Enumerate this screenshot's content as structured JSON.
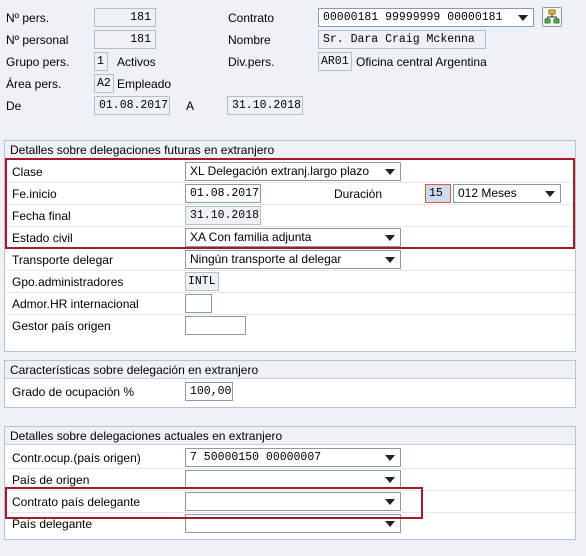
{
  "header": {
    "nr_pers_label": "Nº pers.",
    "nr_pers_value": "181",
    "nr_personal_label": "Nº personal",
    "nr_personal_value": "181",
    "grupo_label": "Grupo pers.",
    "grupo_code": "1",
    "grupo_text": "Activos",
    "area_label": "Área pers.",
    "area_code": "A2",
    "area_text": "Empleado",
    "de_label": "De",
    "de_value": "01.08.2017",
    "a_label": "A",
    "a_value": "31.10.2018",
    "contrato_label": "Contrato",
    "contrato_value": "00000181 99999999 00000181",
    "nombre_label": "Nombre",
    "nombre_value": "Sr. Dara Craig Mckenna",
    "div_label": "Div.pers.",
    "div_code": "AR01",
    "div_text": "Oficina central Argentina"
  },
  "future": {
    "title": "Detalles sobre delegaciones futuras en extranjero",
    "clase_label": "Clase",
    "clase_value": "XL Delegación extranj.largo plazo",
    "feinicio_label": "Fe.inicio",
    "feinicio_value": "01.08.2017",
    "duracion_label": "Duración",
    "duracion_value": "15",
    "duracion_unit": "012 Meses",
    "fechafinal_label": "Fecha final",
    "fechafinal_value": "31.10.2018",
    "estado_label": "Estado civil",
    "estado_value": "XA Con familia adjunta",
    "transporte_label": "Transporte delegar",
    "transporte_value": "Ningún transporte al delegar",
    "gpo_label": "Gpo.administradores",
    "gpo_value": "INTL",
    "admor_label": "Admor.HR internacional",
    "admor_value": "",
    "gestor_label": "Gestor país origen",
    "gestor_value": ""
  },
  "characteristics": {
    "title": "Características sobre delegación en extranjero",
    "grado_label": "Grado de ocupación %",
    "grado_value": "100,00"
  },
  "current": {
    "title": "Detalles sobre delegaciones actuales en extranjero",
    "contr_label": "Contr.ocup.(país origen)",
    "contr_value": "7 50000150 00000007",
    "pais_origen_label": "País de origen",
    "pais_origen_value": "",
    "contrato_del_label": "Contrato país delegante",
    "contrato_del_value": "",
    "pais_del_label": "País delegante",
    "pais_del_value": ""
  },
  "colors": {
    "highlight_border": "#a8182a",
    "background": "#eef2f7"
  }
}
